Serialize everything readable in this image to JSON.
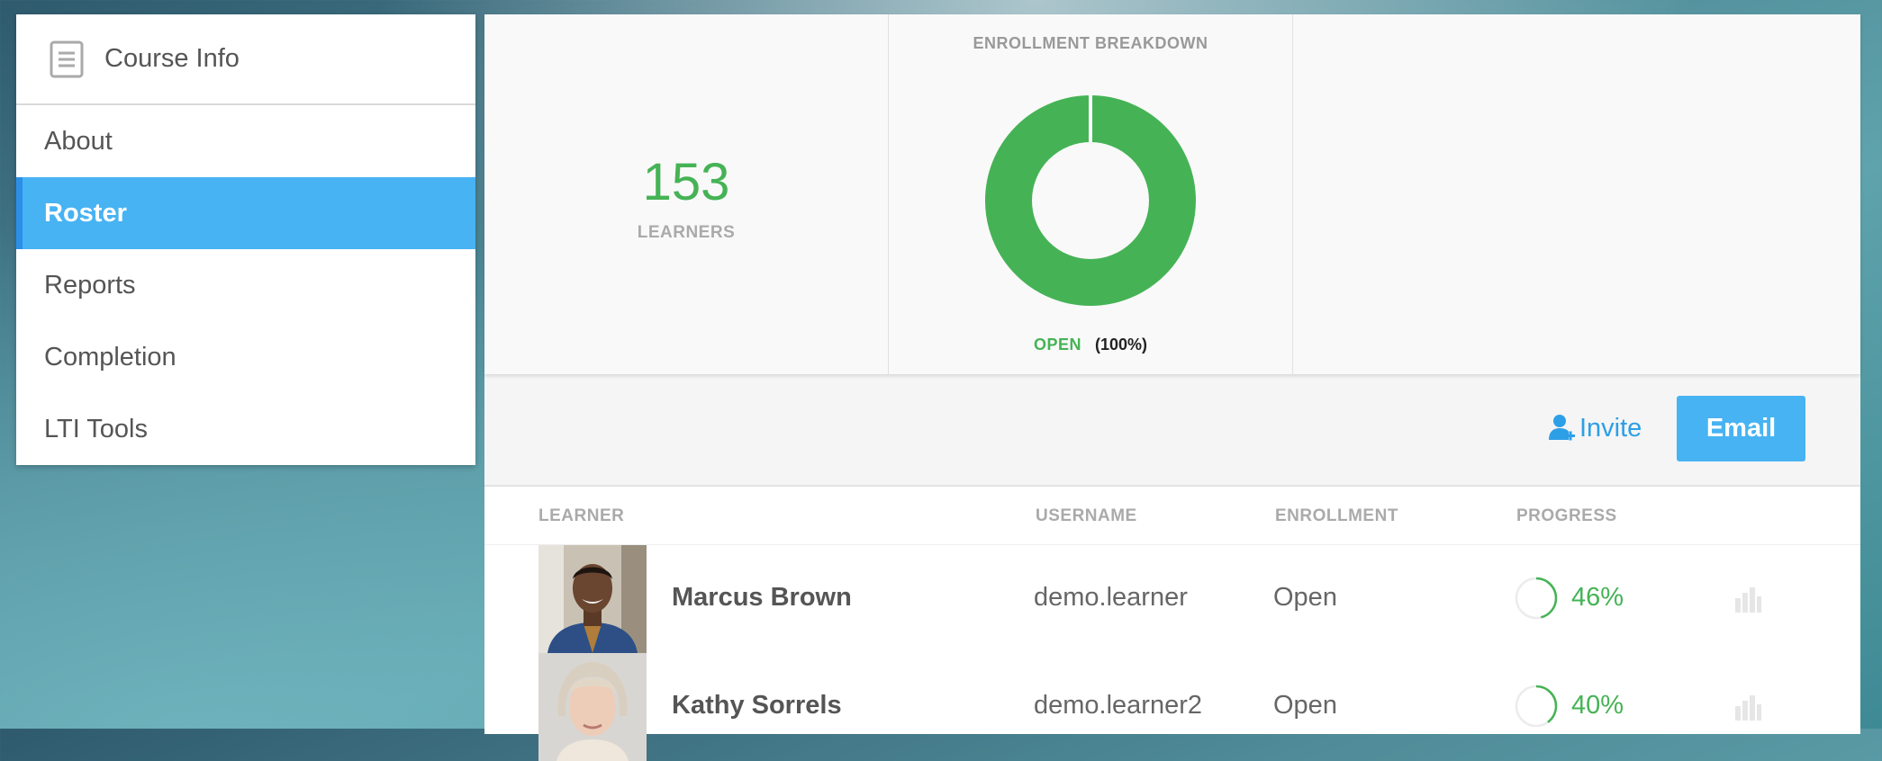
{
  "sidebar": {
    "title": "Course Info",
    "icon": "document-icon",
    "items": [
      {
        "label": "About",
        "active": false
      },
      {
        "label": "Roster",
        "active": true
      },
      {
        "label": "Reports",
        "active": false
      },
      {
        "label": "Completion",
        "active": false
      },
      {
        "label": "LTI Tools",
        "active": false
      }
    ]
  },
  "stats": {
    "learners_count": "153",
    "learners_label": "LEARNERS",
    "breakdown_title": "ENROLLMENT BREAKDOWN",
    "breakdown": [
      {
        "name": "OPEN",
        "percent_label": "(100%)",
        "percent": 100,
        "color": "#45b355"
      }
    ]
  },
  "toolbar": {
    "invite_label": "Invite",
    "email_label": "Email"
  },
  "table": {
    "columns": [
      "LEARNER",
      "USERNAME",
      "ENROLLMENT",
      "PROGRESS"
    ],
    "rows": [
      {
        "name": "Marcus Brown",
        "username": "demo.learner",
        "enrollment": "Open",
        "progress_label": "46%",
        "progress": 0.46
      },
      {
        "name": "Kathy Sorrels",
        "username": "demo.learner2",
        "enrollment": "Open",
        "progress_label": "40%",
        "progress": 0.4
      }
    ]
  },
  "colors": {
    "accent": "#47b3f2",
    "success": "#45b355"
  }
}
